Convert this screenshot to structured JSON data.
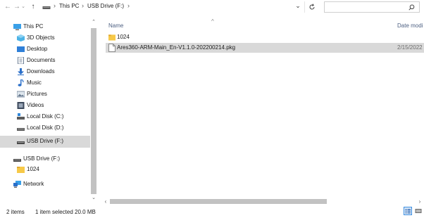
{
  "nav_buttons": {
    "back_icon": "arrow-left-icon",
    "forward_icon": "arrow-right-icon",
    "recent_icon": "chevron-down-icon",
    "up_icon": "arrow-up-icon"
  },
  "address_bar": {
    "crumbs": [
      "This PC",
      "USB Drive (F:)"
    ],
    "separator": "›",
    "dropdown_icon": "chevron-down-icon",
    "refresh_icon": "refresh-icon"
  },
  "search": {
    "placeholder": "",
    "icon": "search-icon"
  },
  "sidebar": {
    "items": [
      {
        "label": "This PC",
        "icon": "computer-icon"
      },
      {
        "label": "3D Objects",
        "icon": "cube-icon"
      },
      {
        "label": "Desktop",
        "icon": "desktop-icon"
      },
      {
        "label": "Documents",
        "icon": "document-icon"
      },
      {
        "label": "Downloads",
        "icon": "download-icon"
      },
      {
        "label": "Music",
        "icon": "music-icon"
      },
      {
        "label": "Pictures",
        "icon": "picture-icon"
      },
      {
        "label": "Videos",
        "icon": "video-icon"
      },
      {
        "label": "Local Disk (C:)",
        "icon": "drive-icon"
      },
      {
        "label": "Local Disk (D:)",
        "icon": "drive-icon"
      },
      {
        "label": "USB Drive (F:)",
        "icon": "usb-drive-icon"
      },
      {
        "label": "USB Drive (F:)",
        "icon": "usb-drive-icon"
      },
      {
        "label": "1024",
        "icon": "folder-icon"
      },
      {
        "label": "Network",
        "icon": "network-icon"
      }
    ],
    "selected_index": 10
  },
  "columns": {
    "name": "Name",
    "date": "Date modi"
  },
  "files": [
    {
      "name": "1024",
      "date": "",
      "type": "folder",
      "icon": "folder-icon",
      "selected": false
    },
    {
      "name": "Ares360-ARM-Main_En-V1.1.0-202200214.pkg",
      "date": "2/15/2022",
      "type": "file",
      "icon": "file-icon",
      "selected": true
    }
  ],
  "status": {
    "items_count": "2 items",
    "selection": "1 item selected  20.0 MB"
  },
  "colors": {
    "selected_bg": "#d9d9d9",
    "folder": "#f7c948",
    "header_text": "#4d6082"
  }
}
